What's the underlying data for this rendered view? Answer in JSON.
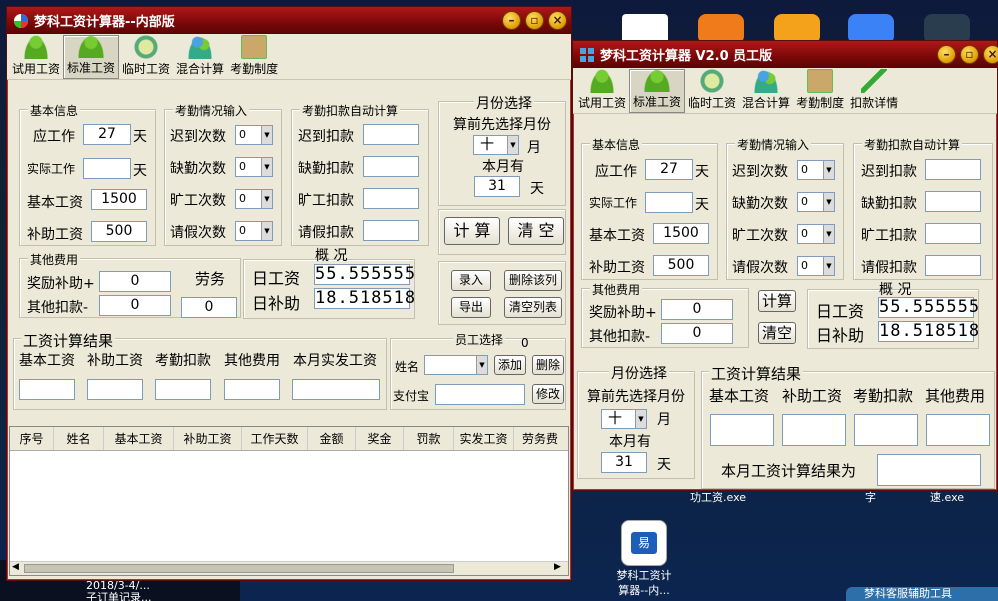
{
  "desktop": {
    "icons": [
      {
        "label": "梦科工资计\n算器--内..."
      }
    ],
    "under_texts": [
      "功工资.exe",
      "字",
      "速.exe"
    ],
    "left_text": "子订单记录...",
    "left_text2": "2018/3-4/...",
    "taskbar_item": "梦科客服辅助工具"
  },
  "win1": {
    "title": "梦科工资计算器--内部版",
    "toolbar": [
      "试用工资",
      "标准工资",
      "临时工资",
      "混合计算",
      "考勤制度"
    ],
    "basic": {
      "title": "基本信息",
      "labels": [
        "应工作",
        "实际工作",
        "基本工资",
        "补助工资"
      ],
      "values": [
        "27",
        "",
        "1500",
        "500"
      ],
      "unit": "天"
    },
    "attend": {
      "title": "考勤情况输入",
      "labels": [
        "迟到次数",
        "缺勤次数",
        "旷工次数",
        "请假次数"
      ],
      "values": [
        "0",
        "0",
        "0",
        "0"
      ]
    },
    "deduct": {
      "title": "考勤扣款自动计算",
      "labels": [
        "迟到扣款",
        "缺勤扣款",
        "旷工扣款",
        "请假扣款"
      ]
    },
    "month": {
      "title": "月份选择",
      "hint": "算前先选择月份",
      "month_value": "十",
      "month_unit": "月",
      "days_label": "本月有",
      "days_value": "31",
      "days_unit": "天"
    },
    "buttons": {
      "calc": "计 算",
      "clear": "清 空"
    },
    "other": {
      "title": "其他费用",
      "labels": [
        "奖励补助+",
        "其他扣款-"
      ],
      "values": [
        "0",
        "0"
      ],
      "labor_label": "劳务",
      "labor_value": "0"
    },
    "overview": {
      "title": "概 况",
      "labels": [
        "日工资",
        "日补助"
      ],
      "values": [
        "55.555555",
        "18.518518"
      ]
    },
    "actions": [
      "录入",
      "删除该列",
      "导出",
      "清空列表"
    ],
    "result": {
      "title": "工资计算结果",
      "cols": [
        "基本工资",
        "补助工资",
        "考勤扣款",
        "其他费用",
        "本月实发工资"
      ]
    },
    "staff": {
      "title": "员工选择",
      "count": "0",
      "name_label": "姓名",
      "add": "添加",
      "del": "删除",
      "alipay_label": "支付宝",
      "edit": "修改"
    },
    "grid_headers": [
      "序号",
      "姓名",
      "基本工资",
      "补助工资",
      "工作天数",
      "金额",
      "奖金",
      "罚款",
      "实发工资",
      "劳务费"
    ]
  },
  "win2": {
    "title": "梦科工资计算器 V2.0 员工版",
    "toolbar": [
      "试用工资",
      "标准工资",
      "临时工资",
      "混合计算",
      "考勤制度",
      "扣款详情"
    ],
    "basic": {
      "title": "基本信息",
      "labels": [
        "应工作",
        "实际工作",
        "基本工资",
        "补助工资"
      ],
      "values": [
        "27",
        "",
        "1500",
        "500"
      ],
      "unit": "天"
    },
    "attend": {
      "title": "考勤情况输入",
      "labels": [
        "迟到次数",
        "缺勤次数",
        "旷工次数",
        "请假次数"
      ],
      "values": [
        "0",
        "0",
        "0",
        "0"
      ]
    },
    "deduct": {
      "title": "考勤扣款自动计算",
      "labels": [
        "迟到扣款",
        "缺勤扣款",
        "旷工扣款",
        "请假扣款"
      ]
    },
    "other": {
      "title": "其他费用",
      "labels": [
        "奖励补助+",
        "其他扣款-"
      ],
      "values": [
        "0",
        "0"
      ]
    },
    "buttons": {
      "calc": "计算",
      "clear": "清空"
    },
    "overview": {
      "title": "概 况",
      "labels": [
        "日工资",
        "日补助"
      ],
      "values": [
        "55.555555",
        "18.518518"
      ]
    },
    "month": {
      "title": "月份选择",
      "hint": "算前先选择月份",
      "month_value": "十",
      "month_unit": "月",
      "days_label": "本月有",
      "days_value": "31",
      "days_unit": "天"
    },
    "result": {
      "title": "工资计算结果",
      "cols": [
        "基本工资",
        "补助工资",
        "考勤扣款",
        "其他费用"
      ],
      "summary": "本月工资计算结果为"
    }
  }
}
